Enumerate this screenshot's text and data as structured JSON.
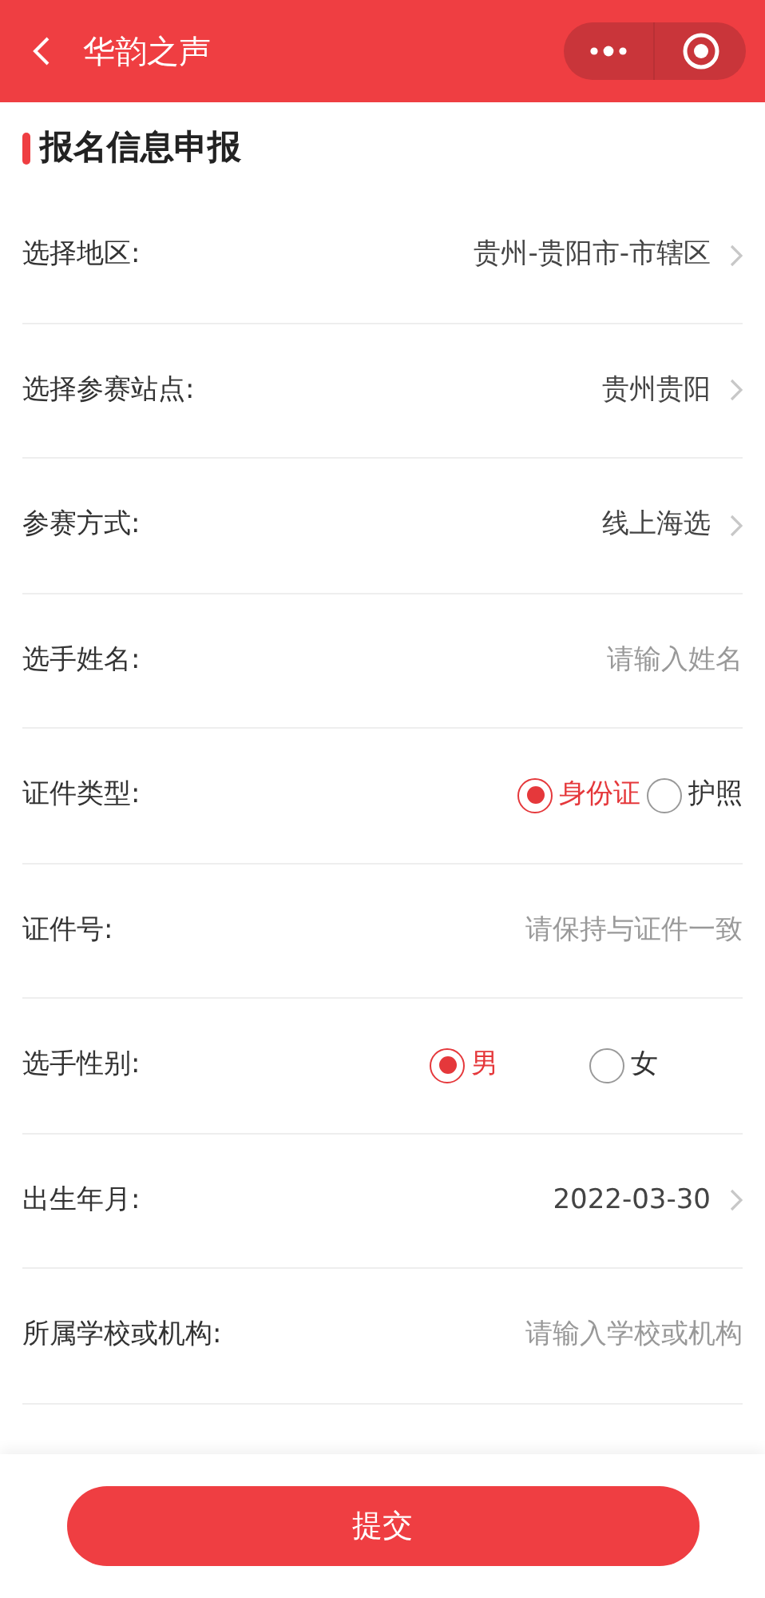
{
  "header": {
    "title": "华韵之声"
  },
  "section_title": "报名信息申报",
  "fields": [
    {
      "kind": "select",
      "label": "选择地区:",
      "value": "贵州-贵阳市-市辖区"
    },
    {
      "kind": "select",
      "label": "选择参赛站点:",
      "value": "贵州贵阳"
    },
    {
      "kind": "select",
      "label": "参赛方式:",
      "value": "线上海选"
    },
    {
      "kind": "input",
      "label": "选手姓名:",
      "placeholder": "请输入姓名"
    },
    {
      "kind": "radio",
      "label": "证件类型:",
      "options": [
        {
          "label": "身份证",
          "selected": true
        },
        {
          "label": "护照",
          "selected": false
        }
      ]
    },
    {
      "kind": "input",
      "label": "证件号:",
      "placeholder": "请保持与证件一致"
    },
    {
      "kind": "radio",
      "label": "选手性别:",
      "options": [
        {
          "label": "男",
          "selected": true
        },
        {
          "label": "女",
          "selected": false
        }
      ]
    },
    {
      "kind": "select",
      "label": "出生年月:",
      "value": "2022-03-30"
    },
    {
      "kind": "input",
      "label": "所属学校或机构:",
      "placeholder": "请输入学校或机构"
    }
  ],
  "submit": "提交"
}
